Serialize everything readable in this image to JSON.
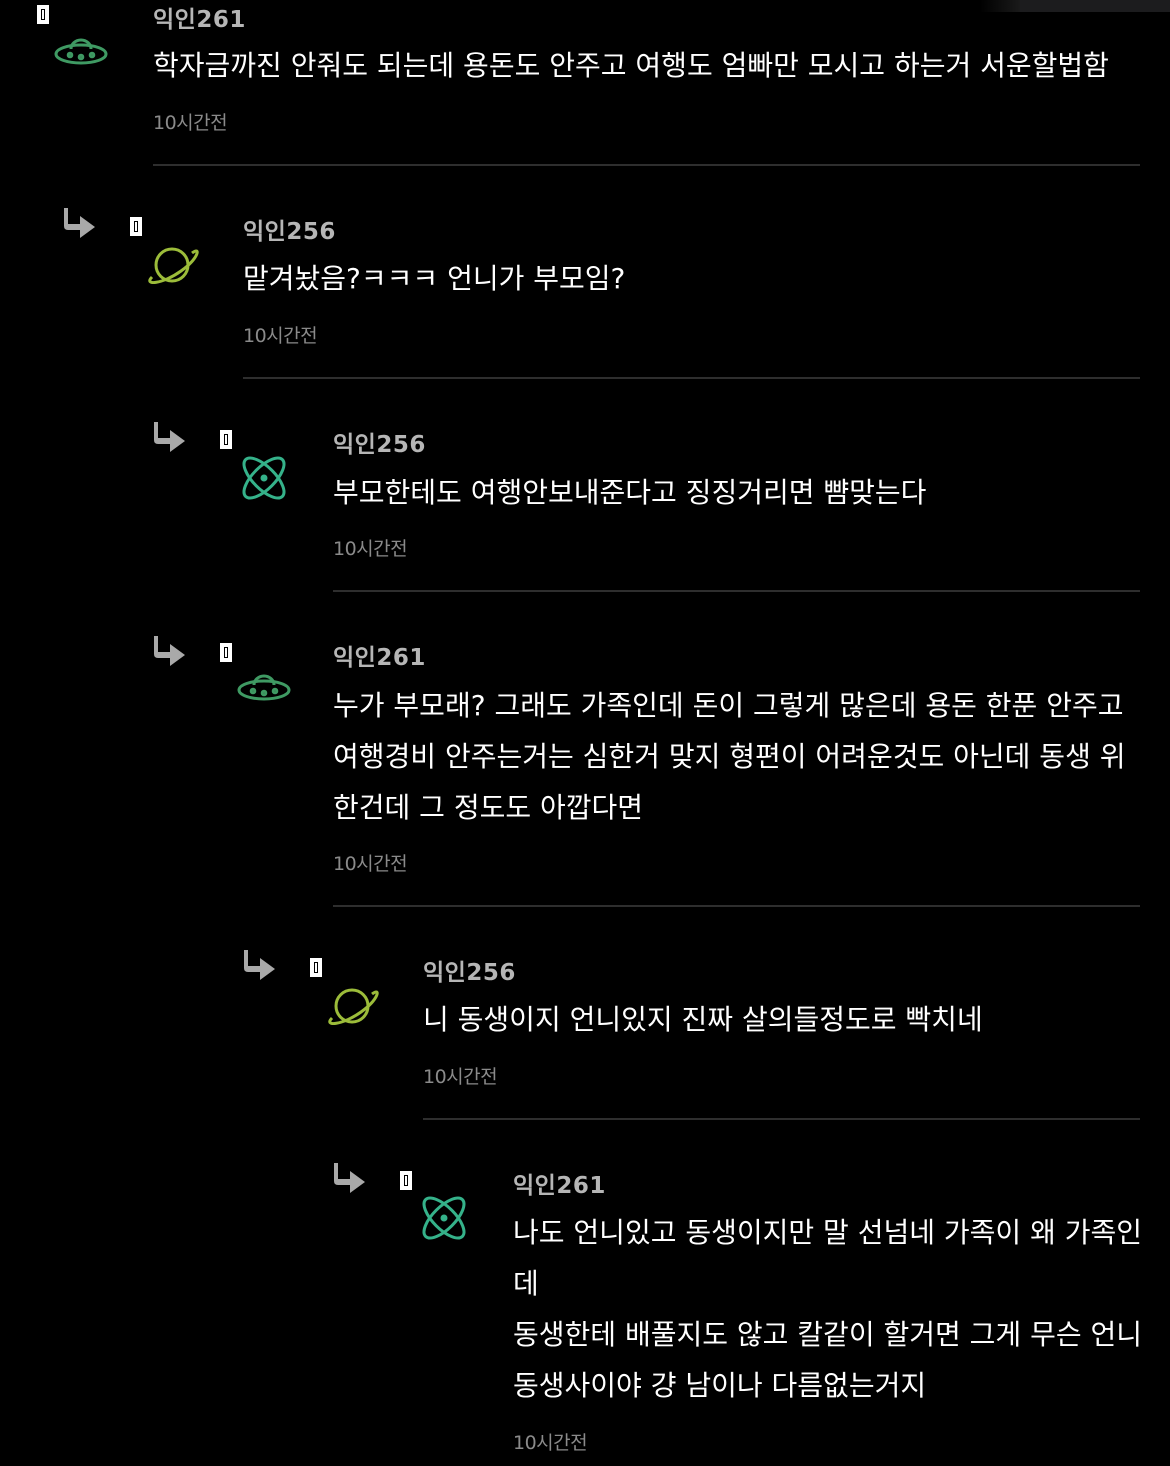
{
  "colors": {
    "background": "#000000",
    "author": "#b6b6b6",
    "body_text": "#ffffff",
    "timestamp": "#8a8a8a",
    "divider": "#2e2e2e",
    "ufo_icon": "#3f9a63",
    "planet_icon": "#9cbc3a",
    "atom_icon": "#35b28a"
  },
  "comments": [
    {
      "author": "익인261",
      "avatar_icon": "ufo-icon",
      "lines": [
        "학자금까진 안줘도 되는데 용돈도 안주고 여행도 엄빠만 모시고 하는거 서운할법함"
      ],
      "time": "10시간전"
    },
    {
      "author": "익인256",
      "avatar_icon": "planet-icon",
      "lines": [
        "맡겨놨음?ㅋㅋㅋ 언니가 부모임?"
      ],
      "time": "10시간전"
    },
    {
      "author": "익인256",
      "avatar_icon": "atom-icon",
      "lines": [
        "부모한테도 여행안보내준다고 징징거리면 뺨맞는다"
      ],
      "time": "10시간전"
    },
    {
      "author": "익인261",
      "avatar_icon": "ufo-icon",
      "lines": [
        "누가 부모래? 그래도 가족인데 돈이 그렇게 많은데 용돈 한푼 안주고",
        "여행경비 안주는거는 심한거 맞지 형편이 어려운것도 아닌데 동생 위",
        "한건데 그 정도도 아깝다면"
      ],
      "time": "10시간전"
    },
    {
      "author": "익인256",
      "avatar_icon": "planet-icon",
      "lines": [
        "니 동생이지 언니있지 진짜 살의들정도로 빡치네"
      ],
      "time": "10시간전"
    },
    {
      "author": "익인261",
      "avatar_icon": "atom-icon",
      "lines": [
        "나도 언니있고 동생이지만 말 선넘네 가족이 왜 가족인",
        "데",
        "동생한테 배풀지도 않고 칼같이 할거면 그게 무슨 언니",
        "동생사이야 걍 남이나 다름없는거지"
      ],
      "time": "10시간전"
    }
  ]
}
